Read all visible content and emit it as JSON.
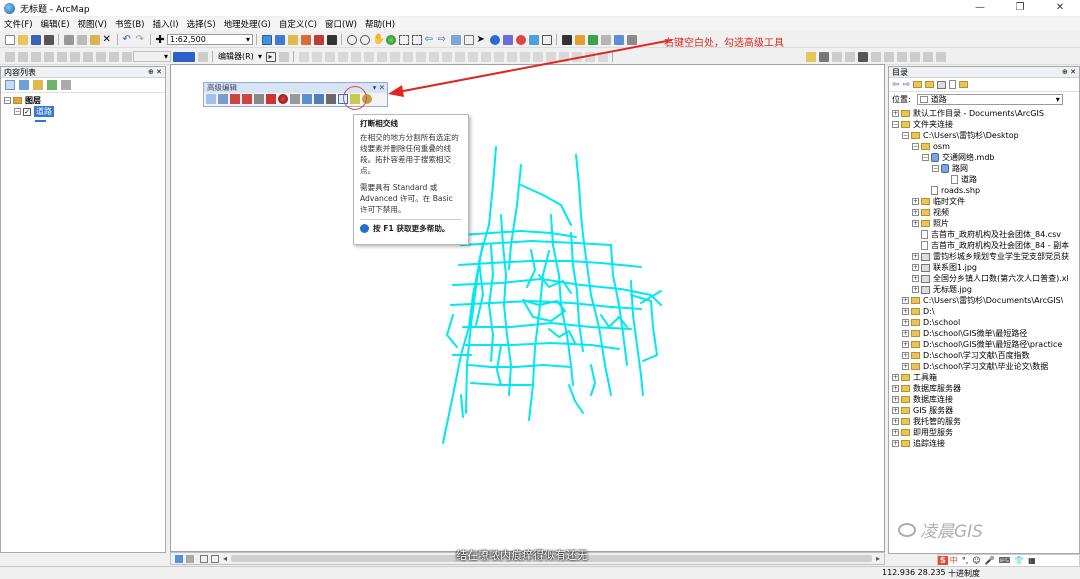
{
  "window": {
    "title": "无标题 - ArcMap"
  },
  "menu": [
    "文件(F)",
    "编辑(E)",
    "视图(V)",
    "书签(B)",
    "插入(I)",
    "选择(S)",
    "地理处理(G)",
    "自定义(C)",
    "窗口(W)",
    "帮助(H)"
  ],
  "toolbar": {
    "scale": "1:62,500",
    "editor_label": "编辑器(R)"
  },
  "annotation": "右键空白处，勾选高级工具",
  "toc": {
    "title": "内容列表",
    "layers_label": "图层",
    "layer_name": "道路"
  },
  "advanced_editing": {
    "title": "高级编辑"
  },
  "tooltip": {
    "title": "打断相交线",
    "body": "在相交的地方分割所有选定的线要素并删除任何重叠的线段。拓扑容差用于搜索相交点。",
    "license": "需要具有 Standard 或 Advanced 许可。在 Basic 许可下禁用。",
    "help": "按 F1 获取更多帮助。"
  },
  "catalog": {
    "title": "目录",
    "location_label": "位置:",
    "location_value": "道路",
    "items": [
      {
        "label": "默认工作目录 - Documents\\ArcGIS",
        "level": 0,
        "pm": "+",
        "icon": "fold"
      },
      {
        "label": "文件夹连接",
        "level": 0,
        "pm": "−",
        "icon": "fold"
      },
      {
        "label": "C:\\Users\\雷钧杉\\Desktop",
        "level": 1,
        "pm": "−",
        "icon": "fold"
      },
      {
        "label": "osm",
        "level": 2,
        "pm": "−",
        "icon": "fold"
      },
      {
        "label": "交通网络.mdb",
        "level": 3,
        "pm": "−",
        "icon": "db"
      },
      {
        "label": "路网",
        "level": 4,
        "pm": "−",
        "icon": "db"
      },
      {
        "label": "道路",
        "level": 5,
        "pm": "",
        "icon": "fil"
      },
      {
        "label": "roads.shp",
        "level": 3,
        "pm": "",
        "icon": "fil"
      },
      {
        "label": "临时文件",
        "level": 2,
        "pm": "+",
        "icon": "fold"
      },
      {
        "label": "视频",
        "level": 2,
        "pm": "+",
        "icon": "fold"
      },
      {
        "label": "照片",
        "level": 2,
        "pm": "+",
        "icon": "fold"
      },
      {
        "label": "吉首市_政府机构及社会团体_84.csv",
        "level": 2,
        "pm": "",
        "icon": "fil"
      },
      {
        "label": "吉首市_政府机构及社会团体_84 - 副本",
        "level": 2,
        "pm": "",
        "icon": "fil"
      },
      {
        "label": "雷钧杉城乡规划专业学生党支部党员获",
        "level": 2,
        "pm": "+",
        "icon": "img"
      },
      {
        "label": "联系图1.jpg",
        "level": 2,
        "pm": "+",
        "icon": "img"
      },
      {
        "label": "全国分乡镇人口数(第六次人口普查).xl",
        "level": 2,
        "pm": "+",
        "icon": "img"
      },
      {
        "label": "无标题.jpg",
        "level": 2,
        "pm": "+",
        "icon": "img"
      },
      {
        "label": "C:\\Users\\雷钧杉\\Documents\\ArcGIS\\",
        "level": 1,
        "pm": "+",
        "icon": "fold"
      },
      {
        "label": "D:\\",
        "level": 1,
        "pm": "+",
        "icon": "fold"
      },
      {
        "label": "D:\\school",
        "level": 1,
        "pm": "+",
        "icon": "fold"
      },
      {
        "label": "D:\\school\\GIS微单\\最短路径",
        "level": 1,
        "pm": "+",
        "icon": "fold"
      },
      {
        "label": "D:\\school\\GIS微单\\最短路径\\practice",
        "level": 1,
        "pm": "+",
        "icon": "fold"
      },
      {
        "label": "D:\\school\\学习文献\\百度指数",
        "level": 1,
        "pm": "+",
        "icon": "fold"
      },
      {
        "label": "D:\\school\\学习文献\\毕业论文\\数据",
        "level": 1,
        "pm": "+",
        "icon": "fold"
      },
      {
        "label": "工具箱",
        "level": 0,
        "pm": "+",
        "icon": "fold"
      },
      {
        "label": "数据库服务器",
        "level": 0,
        "pm": "+",
        "icon": "fold"
      },
      {
        "label": "数据库连接",
        "level": 0,
        "pm": "+",
        "icon": "fold"
      },
      {
        "label": "GIS 服务器",
        "level": 0,
        "pm": "+",
        "icon": "fold"
      },
      {
        "label": "我托管的服务",
        "level": 0,
        "pm": "+",
        "icon": "fold"
      },
      {
        "label": "即用型服务",
        "level": 0,
        "pm": "+",
        "icon": "fold"
      },
      {
        "label": "追踪连接",
        "level": 0,
        "pm": "+",
        "icon": "fold"
      }
    ]
  },
  "subtitle": "结在嘹哝内痕痒得似有还无",
  "watermark": "凌晨GIS",
  "status": {
    "coords": "112.936  28.235",
    "unit": "十进制度",
    "ime": "中"
  }
}
